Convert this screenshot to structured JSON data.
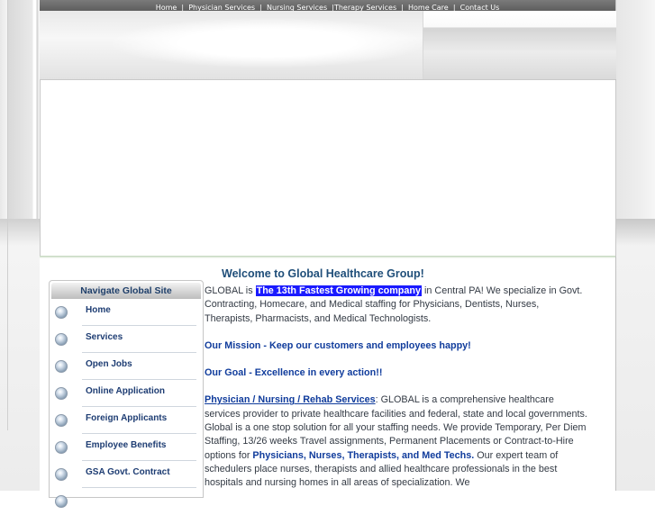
{
  "top_nav": {
    "items": [
      "Home",
      "Physician Services",
      "Nursing Services",
      "Therapy Services",
      "Home Care",
      "Contact Us"
    ],
    "separator": "|"
  },
  "welcome": "Welcome to Global Healthcare Group!",
  "sidenav": {
    "title": "Navigate Global Site",
    "items": [
      "Home",
      "Services",
      "Open Jobs",
      "Online Application",
      "Foreign Applicants",
      "Employee Benefits",
      "GSA Govt. Contract"
    ]
  },
  "body": {
    "intro_prefix": "GLOBAL is ",
    "intro_highlight": "The 13th Fastest Growing company",
    "intro_suffix": " in Central PA! We specialize in Govt. Contracting, Homecare, and Medical staffing for Physicians, Dentists, Nurses, Therapists, Pharmacists, and Medical Technologists.",
    "mission": "Our Mission - Keep our customers and employees happy!",
    "goal": "Our Goal - Excellence in every action!!",
    "services_link": "Physician / Nursing / Rehab Services",
    "services_text_1": ": GLOBAL is a comprehensive healthcare services provider to private healthcare facilities and federal, state and local governments. Global is a one stop solution for all your staffing needs. We provide Temporary, Per Diem Staffing, 13/26 weeks Travel assignments, Permanent Placements or Contract-to-Hire options for ",
    "services_bold": "Physicians, Nurses, Therapists, and Med Techs.",
    "services_text_2": " Our expert team of schedulers place nurses, therapists and allied healthcare professionals in the best hospitals and nursing homes in all areas of specialization. We"
  },
  "colors": {
    "highlight_bg": "#1a1aff",
    "link_blue": "#103c9c",
    "heading_blue": "#1f4e79",
    "nav_bar": "#6a6a6a"
  }
}
